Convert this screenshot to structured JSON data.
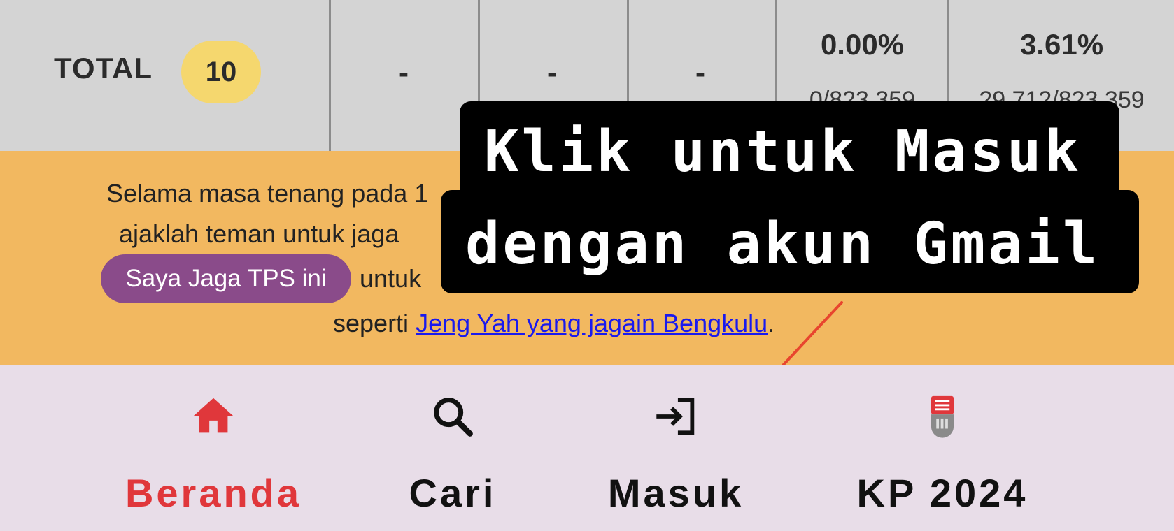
{
  "table": {
    "total_label": "TOTAL",
    "total_count": "10",
    "col1": "-",
    "col2": "-",
    "col3": "-",
    "col4_percent": "0.00%",
    "col4_fraction": "0/823.359",
    "col5_percent": "3.61%",
    "col5_fraction": "29.712/823.359"
  },
  "banner": {
    "line1": "Selama masa tenang pada 1",
    "line2": "ajaklah teman untuk jaga",
    "cta_label": "Saya Jaga TPS ini",
    "line3_after": "untuk",
    "line4_before": "seperti",
    "link_text": "Jeng Yah yang jagain Bengkulu",
    "line4_after": "."
  },
  "callout": {
    "line1": "Klik untuk Masuk",
    "line2": "dengan akun Gmail"
  },
  "nav": {
    "items": [
      {
        "label": "Beranda",
        "icon": "home-icon",
        "active": true
      },
      {
        "label": "Cari",
        "icon": "search-icon",
        "active": false
      },
      {
        "label": "Masuk",
        "icon": "login-icon",
        "active": false
      },
      {
        "label": "KP 2024",
        "icon": "ballot-box-icon",
        "active": false
      }
    ]
  },
  "colors": {
    "active": "#e0373b",
    "banner_bg": "#f2b860",
    "cta_bg": "#8a4b8a",
    "badge_bg": "#f5d76e",
    "arrow": "#e8452e"
  }
}
